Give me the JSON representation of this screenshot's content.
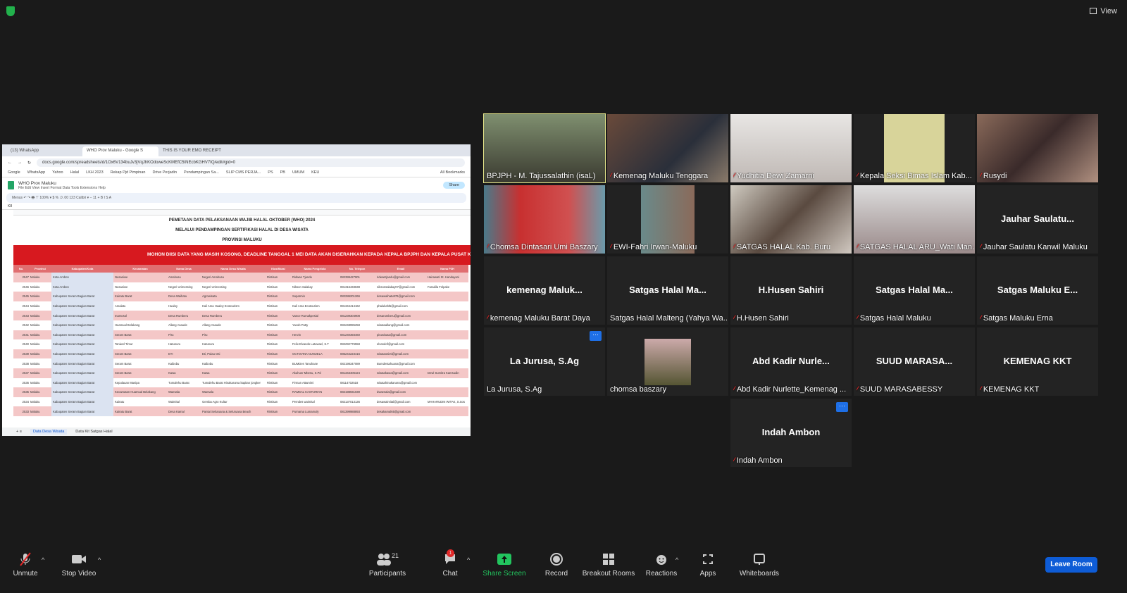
{
  "top": {
    "view_label": "View"
  },
  "browser": {
    "tabs": [
      "(13) WhatsApp",
      "WHO Prov Maluku - Google S",
      "THIS IS YOUR EMO RECEIPT"
    ],
    "url": "docs.google.com/spreadsheets/d/1Ox6V134buJv3jVqJhKOdoweScKMEfC5tNEcbKGHV7IQ/edit#gid=0",
    "bookmarks": [
      "Google",
      "WhatsApp",
      "Yahoo",
      "Halal",
      "LKH 2023",
      "Rekap Pjd Pimpinan",
      "Drive Perjadin",
      "Pendampingan Sa...",
      "SLIP CMS PERJA...",
      "PS",
      "PB",
      "UMUM",
      "KEU",
      "All Bookmarks"
    ]
  },
  "sheet": {
    "title": "WHO Prov Maluku",
    "menu": "File  Edit  View  Insert  Format  Data  Tools  Extensions  Help",
    "share_label": "Share",
    "toolbar": "Menus   ↶ ↷ 🖶 ⊤  100% ▾   $  %  .0  .00  123   Calibri ▾  −  11  +  B  I  S  A",
    "cell_ref": "K8",
    "title1": "PEMETAAN DATA PELAKSANAAN WAJIB HALAL OKTOBER (WHO) 2024",
    "title2": "MELALUI PENDAMPINGAN SERTIFIKASI HALAL DI DESA WISATA",
    "title3": "PROVINSI MALUKU",
    "banner": "MOHON DIISI DATA YANG MASIH KOSONG, DEADLINE TANGGAL 1 MEI DATA AKAN DISERAHKAN KEPADA KEPALA BPJPH DAN KEPALA PUSAT KERJASAMA",
    "headers": [
      "No.",
      "Provinsi",
      "Kabupaten/Kota",
      "Kecamatan",
      "Nama Desa",
      "Nama Desa Wisata",
      "Klasifikasi",
      "Nama Pengelola",
      "No. Telepon",
      "Email",
      "Nama P3H"
    ],
    "rows": [
      [
        "2547",
        "Maluku",
        "Kota Ambon",
        "Nusaniwe",
        "Amahusu",
        "Negeri Amahusu",
        "Rintisan",
        "Ridwan Tjandu",
        "082399427901",
        "ridwantjandu@gmail.com",
        "Hairawati St. Handayani"
      ],
      [
        "2546",
        "Maluku",
        "Kota Ambon",
        "Nusaniwe",
        "Negeri Urimessing",
        "Negeri Urimessing",
        "Rintisan",
        "Nikson Salakay",
        "081316433638",
        "niksonsalakay07@gmail.com",
        "Faradila Folpake"
      ],
      [
        "2545",
        "Maluku",
        "Kabupaten Seram Bagian Barat",
        "Kairatu Barat",
        "Desa Waihatu",
        "Agrowisata",
        "Rintisan",
        "Suparmin",
        "082286201266",
        "desawaihatu876@gmail.com",
        ""
      ],
      [
        "2544",
        "Maluku",
        "Kabupaten Seram Bagian Barat",
        "Amalatu",
        "Hualoy",
        "Kali Ama Hualoy Ecotourism",
        "Rintisan",
        "Kali Ama Ecotourism",
        "081344414162",
        "phalukahl5@gmail.com",
        ""
      ],
      [
        "2543",
        "Maluku",
        "Kabupaten Seram Bagian Barat",
        "Inamosol",
        "Desa Rumberu",
        "Desa Rumberu",
        "Rintisan",
        "Vance Rumakpesial",
        "081239304908",
        "desarumberu@gmail.com",
        ""
      ],
      [
        "2542",
        "Maluku",
        "Kabupaten Seram Bagian Barat",
        "Huamual Belakang",
        "Allang Asaude",
        "Allang Asaude",
        "Rintisan",
        "Yacob Patty",
        "082248995258",
        "wisataallang@gmail.com",
        ""
      ],
      [
        "2541",
        "Maluku",
        "Kabupaten Seram Bagian Barat",
        "Seram Barat",
        "Piru",
        "Piru",
        "Rintisan",
        "Hervin",
        "081240393460",
        "piruwisata@gmail.com",
        ""
      ],
      [
        "2540",
        "Maluku",
        "Kabupaten Seram Bagian Barat",
        "Taniwel Timur",
        "Hatunuru",
        "Hatunuru",
        "Rintisan",
        "Felix Elvando Latuwael, S.T",
        "082292776558",
        "elvandof@gmail.com",
        ""
      ],
      [
        "2539",
        "Maluku",
        "Kabupaten Seram Bagian Barat",
        "Seram Barat",
        "ETI",
        "Eti, Pulau Osi",
        "Rintisan",
        "OCTOVINA NUNUELA",
        "085244223416",
        "wisataosieti@gmail.com",
        ""
      ],
      [
        "2538",
        "Maluku",
        "Kabupaten Seram Bagian Barat",
        "Seram Barat",
        "Kaibobu",
        "Kaibobu",
        "Rintisan",
        "BUMDes Tanuhane",
        "082198347089",
        "Bumdestahuana@gmail.com",
        ""
      ],
      [
        "2537",
        "Maluku",
        "Kabupaten Seram Bagian Barat",
        "Seram Barat",
        "Kawa",
        "Kawa",
        "Rintisan",
        "Akuhuer Mbesu, S.Pd",
        "081343406424",
        "wisatakawa@gmail.com",
        "Dewi Sumitra Kamsudin"
      ],
      [
        "2536",
        "Maluku",
        "Kabupaten Seram Bagian Barat",
        "Kepulauan Manipa",
        "Tumalehu Barat",
        "Tumalehu Barat Hinakaruma kapitan jongker",
        "Rintisan",
        "Firman Attamimi",
        "08114702518",
        "wisatahinakaruma@gmail.com",
        ""
      ],
      [
        "2535",
        "Maluku",
        "Kabupaten Seram Bagian Barat",
        "Kecamatan Huamual Belakang",
        "Waesala",
        "Waesala",
        "Rintisan",
        "RAMSAL KASTURIAN",
        "082198931039",
        "dwaesala@gmail.com",
        ""
      ],
      [
        "2534",
        "Maluku",
        "Kabupaten Seram Bagian Barat",
        "Kairatu",
        "Waimital",
        "Gemba Agro Kultur",
        "Rintisan",
        "Pemdes waimital",
        "082137013136",
        "desawaimital@gmail.com",
        "MAHARUDIN WITAK, S.Sos"
      ],
      [
        "2533",
        "Maluku",
        "Kabupaten Seram Bagian Barat",
        "Kairatu Barat",
        "Desa Kamal",
        "Pantai Seluruana & Seluruana Beach",
        "Rintisan",
        "Purnama Lumamuly",
        "081399988893",
        "desakamal65@gmail.com",
        ""
      ]
    ],
    "sheet_tabs": [
      "Data Desa Wisata",
      "Data Kit Satgas Halal"
    ]
  },
  "tiles": [
    {
      "name": "BPJPH - M. Tajussalathin (isaL)",
      "muted": false,
      "video": true,
      "speaking": true
    },
    {
      "name": "Kemenag Maluku Tenggara",
      "muted": true,
      "video": true
    },
    {
      "name": "Yudhitia Dewi Zamarni",
      "muted": true,
      "video": true
    },
    {
      "name": "Kepala Seksi Bimas Islam Kab...",
      "muted": true,
      "video": true
    },
    {
      "name": "Rusydi",
      "muted": true,
      "video": true
    },
    {
      "name": "Chomsa Dintasari Umi Baszary",
      "muted": true,
      "video": true
    },
    {
      "name": "EWI-Fahri Irwan-Maluku",
      "muted": true,
      "video": true
    },
    {
      "name": "SATGAS HALAL Kab. Buru",
      "muted": true,
      "video": true
    },
    {
      "name": "SATGAS HALAL ARU_Wati Man...",
      "muted": true,
      "video": true
    },
    {
      "name": "Jauhar Saulatu Kanwil Maluku",
      "display": "Jauhar  Saulatu...",
      "muted": true,
      "video": false
    },
    {
      "name": "kemenag Maluku Barat Daya",
      "display": "kemenag  Maluk...",
      "muted": true,
      "video": false
    },
    {
      "name": "Satgas Halal Malteng (Yahya Wa...",
      "display": "Satgas  Halal  Ma...",
      "muted": false,
      "video": false
    },
    {
      "name": "H.Husen Sahiri",
      "display": "H.Husen  Sahiri",
      "muted": true,
      "video": false
    },
    {
      "name": "Satgas Halal Maluku",
      "display": "Satgas  Halal  Ma...",
      "muted": true,
      "video": false
    },
    {
      "name": "Satgas Maluku Erna",
      "display": "Satgas  Maluku  E...",
      "muted": true,
      "video": false
    },
    {
      "name": "La Jurusa, S.Ag",
      "display": "La Jurusa, S.Ag",
      "muted": false,
      "video": false,
      "more": true
    },
    {
      "name": "chomsa baszary",
      "muted": false,
      "video": false,
      "picture": true
    },
    {
      "name": "Abd Kadir Nurlette_Kemenag ...",
      "display": "Abd  Kadir  Nurle...",
      "muted": true,
      "video": false
    },
    {
      "name": "SUUD MARASABESSY",
      "display": "SUUD  MARASA...",
      "muted": true,
      "video": false
    },
    {
      "name": "KEMENAG KKT",
      "display": "KEMENAG  KKT",
      "muted": true,
      "video": false
    },
    {
      "name": "Indah Ambon",
      "display": "Indah Ambon",
      "muted": true,
      "video": false,
      "more": true
    }
  ],
  "toolbar": {
    "unmute": "Unmute",
    "stop_video": "Stop Video",
    "participants": "Participants",
    "participants_count": "21",
    "chat": "Chat",
    "chat_badge": "1",
    "share": "Share Screen",
    "record": "Record",
    "breakout": "Breakout Rooms",
    "reactions": "Reactions",
    "apps": "Apps",
    "whiteboards": "Whiteboards",
    "leave": "Leave Room"
  },
  "colors": {
    "share_green": "#22c55e",
    "leave_blue": "#0e5cd6",
    "speaker_outline": "#e5e58a",
    "muted_red": "#e02828",
    "banner_red": "#d7191f"
  }
}
